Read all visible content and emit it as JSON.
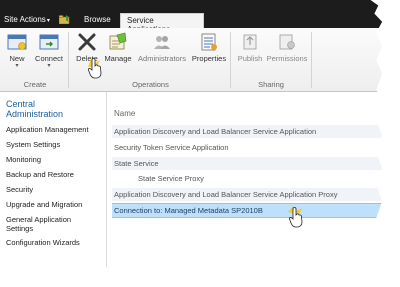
{
  "topbar": {
    "site_actions_label": "Site Actions",
    "tabs": [
      {
        "label": "Browse",
        "active": false
      },
      {
        "label": "Service Applications",
        "active": true
      }
    ]
  },
  "ribbon": {
    "groups": [
      {
        "label": "Create",
        "buttons": [
          {
            "label": "New",
            "icon": "new-icon"
          },
          {
            "label": "Connect",
            "icon": "connect-icon"
          }
        ]
      },
      {
        "label": "Operations",
        "buttons": [
          {
            "label": "Delete",
            "icon": "delete-icon"
          },
          {
            "label": "Manage",
            "icon": "manage-icon"
          },
          {
            "label": "Administrators",
            "icon": "administrators-icon"
          },
          {
            "label": "Properties",
            "icon": "properties-icon"
          }
        ]
      },
      {
        "label": "Sharing",
        "buttons": [
          {
            "label": "Publish",
            "icon": "publish-icon"
          },
          {
            "label": "Permissions",
            "icon": "permissions-icon"
          }
        ]
      }
    ]
  },
  "quicklaunch": {
    "heading": "Central Administration",
    "heading_line1": "Central",
    "heading_line2": "Administration",
    "items": [
      "Application Management",
      "System Settings",
      "Monitoring",
      "Backup and Restore",
      "Security",
      "Upgrade and Migration",
      "General Application Settings",
      "Configuration Wizards"
    ],
    "general_line1": "General Application",
    "general_line2": "Settings"
  },
  "main": {
    "column_header": "Name",
    "rows": [
      {
        "name": "Application Discovery and Load Balancer Service Application",
        "indent": false,
        "selected": false
      },
      {
        "name": "Security Token Service Application",
        "indent": false,
        "selected": false
      },
      {
        "name": "State Service",
        "indent": false,
        "selected": false
      },
      {
        "name": "State Service Proxy",
        "indent": true,
        "selected": false
      },
      {
        "name": "Application Discovery and Load Balancer Service Application Proxy",
        "indent": false,
        "selected": false
      },
      {
        "name": "Connection to: Managed Metadata SP2010B",
        "indent": false,
        "selected": true
      }
    ]
  },
  "colors": {
    "topbar_bg": "#1c1c1c",
    "link_blue": "#1e5e9e",
    "selected_row": "#bfe0fa"
  }
}
